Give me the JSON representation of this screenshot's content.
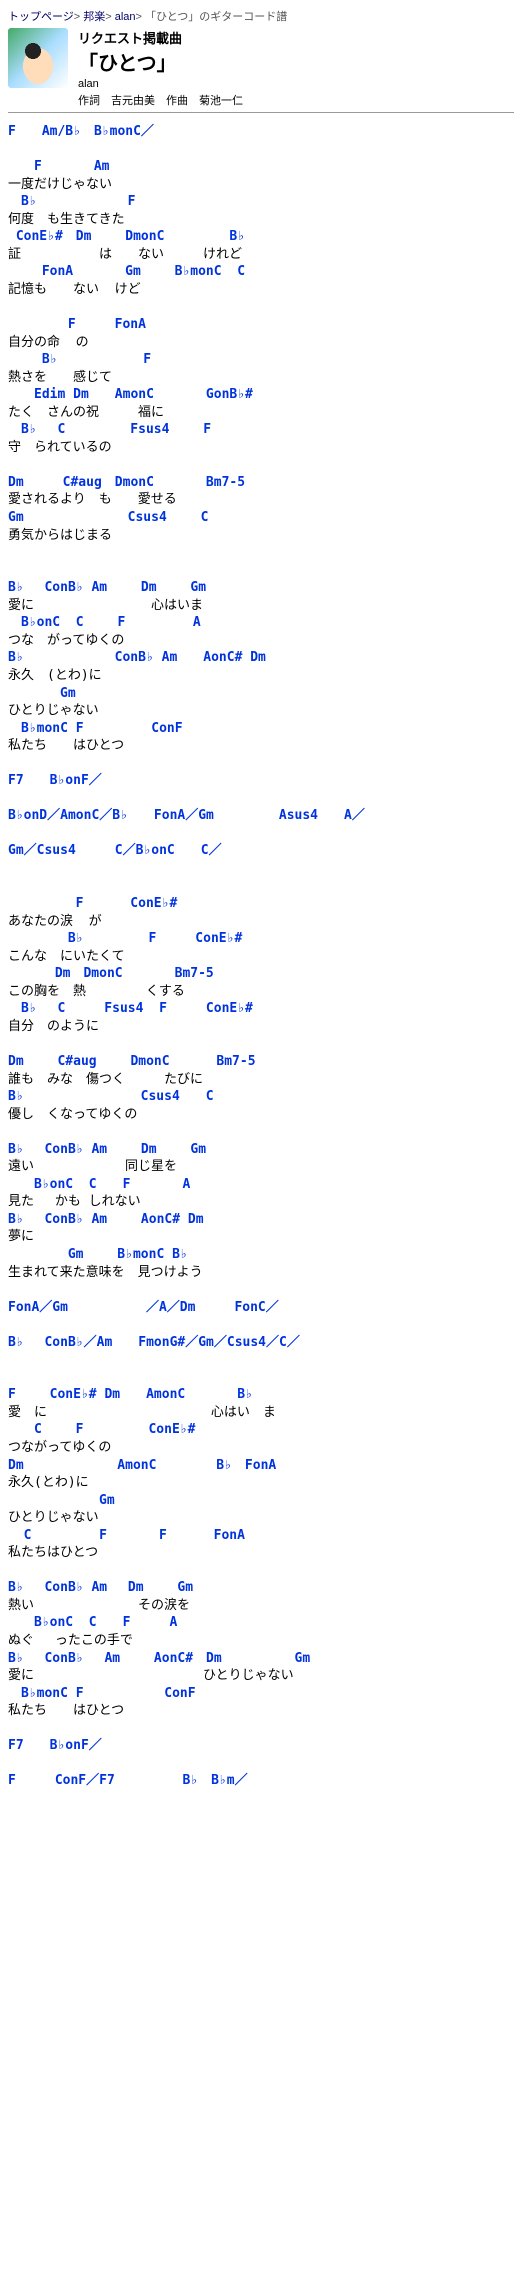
{
  "bc": {
    "p1": "トップページ",
    "p2": "邦楽",
    "p3": "alan",
    "tail": "「ひとつ」のギターコード譜"
  },
  "hd": {
    "req": "リクエスト掲載曲",
    "title": "「ひとつ」",
    "artist": "alan",
    "credit": "作詞　吉元由美　作曲　菊池一仁"
  },
  "lines": [
    {
      "t": "c",
      "v": "F　　Am/B♭　B♭monC／"
    },
    {
      "t": "b"
    },
    {
      "t": "c",
      "v": "　　F　　　　Am"
    },
    {
      "t": "l",
      "v": "一度だけじゃない"
    },
    {
      "t": "c",
      "v": "　B♭　　　　　　　F"
    },
    {
      "t": "l",
      "v": "何度　も生きてきた"
    },
    {
      "t": "c",
      "v": " ConE♭#　Dm　　 DmonC　　　　　B♭"
    },
    {
      "t": "l",
      "v": "証　　　　　　は　　ない　　　けれど"
    },
    {
      "t": "c",
      "v": "　　 FonA　　　　Gm　　 B♭monC  C"
    },
    {
      "t": "l",
      "v": "記憶も　　ない  けど"
    },
    {
      "t": "b"
    },
    {
      "t": "c",
      "v": "　　　　 F　　　FonA"
    },
    {
      "t": "l",
      "v": "自分の命  の"
    },
    {
      "t": "c",
      "v": "　　 B♭　　　　　　 F"
    },
    {
      "t": "l",
      "v": "熱さを　　感じて"
    },
    {
      "t": "c",
      "v": "　　Edim Dm　　AmonC　　　　GonB♭#"
    },
    {
      "t": "l",
      "v": "たく　さんの祝　　　福に"
    },
    {
      "t": "c",
      "v": "　B♭　 C　　　　　Fsus4　　 F"
    },
    {
      "t": "l",
      "v": "守　られているの"
    },
    {
      "t": "b"
    },
    {
      "t": "c",
      "v": "Dm　　　C#aug　DmonC　　　　Bm7-5"
    },
    {
      "t": "l",
      "v": "愛されるより　も　　愛せる"
    },
    {
      "t": "c",
      "v": "Gm　　　　　　　　Csus4　　 C"
    },
    {
      "t": "l",
      "v": "勇気からはじまる"
    },
    {
      "t": "b"
    },
    {
      "t": "b"
    },
    {
      "t": "c",
      "v": "B♭　 ConB♭ Am　　 Dm　　 Gm"
    },
    {
      "t": "l",
      "v": "愛に　　　　　　　　　心はいま"
    },
    {
      "t": "c",
      "v": "　B♭onC  C　　 F　　　　  A"
    },
    {
      "t": "l",
      "v": "つな　がってゆくの"
    },
    {
      "t": "c",
      "v": "B♭　　　　　　　ConB♭ Am　　AonC# Dm"
    },
    {
      "t": "l",
      "v": "永久　(とわ)に"
    },
    {
      "t": "c",
      "v": "　　　　Gm"
    },
    {
      "t": "l",
      "v": "ひとりじゃない"
    },
    {
      "t": "c",
      "v": "　B♭monC F　　　　  ConF"
    },
    {
      "t": "l",
      "v": "私たち　　はひとつ"
    },
    {
      "t": "b"
    },
    {
      "t": "c",
      "v": "F7　　B♭onF／"
    },
    {
      "t": "b"
    },
    {
      "t": "c",
      "v": "B♭onD／AmonC／B♭　　FonA／Gm　　　　　Asus4　　A／"
    },
    {
      "t": "b"
    },
    {
      "t": "c",
      "v": "Gm／Csus4　　　C／B♭onC　　C／"
    },
    {
      "t": "b"
    },
    {
      "t": "b"
    },
    {
      "t": "c",
      "v": "　　　　  F　　　 ConE♭#"
    },
    {
      "t": "l",
      "v": "あなたの涙  が"
    },
    {
      "t": "c",
      "v": "　　　　 B♭　　　　　F　　　ConE♭#"
    },
    {
      "t": "l",
      "v": "こんな　にいたくて"
    },
    {
      "t": "c",
      "v": "　　　 Dm　DmonC　　　　Bm7-5"
    },
    {
      "t": "l",
      "v": "この胸を　熱　　　　 くする"
    },
    {
      "t": "c",
      "v": "　B♭　 C　　　Fsus4  F　　　ConE♭#"
    },
    {
      "t": "l",
      "v": "自分　のように"
    },
    {
      "t": "b"
    },
    {
      "t": "c",
      "v": "Dm　　 C#aug　 　DmonC　 　　Bm7-5"
    },
    {
      "t": "l",
      "v": "誰も　みな　傷つく　　　たびに"
    },
    {
      "t": "c",
      "v": "B♭　　　　　　　　　Csus4　　C"
    },
    {
      "t": "l",
      "v": "優し　くなってゆくの"
    },
    {
      "t": "b"
    },
    {
      "t": "c",
      "v": "B♭　 ConB♭ Am　　 Dm　　 Gm"
    },
    {
      "t": "l",
      "v": "遠い　　　　　　　同じ星を"
    },
    {
      "t": "c",
      "v": "　　B♭onC  C　　F　　　　A"
    },
    {
      "t": "l",
      "v": "見た　 かも しれない"
    },
    {
      "t": "c",
      "v": "B♭　 ConB♭ Am　　 AonC# Dm"
    },
    {
      "t": "l",
      "v": "夢に"
    },
    {
      "t": "c",
      "v": "　　　　 Gm　　 B♭monC B♭"
    },
    {
      "t": "l",
      "v": "生まれて来た意味を　見つけよう"
    },
    {
      "t": "b"
    },
    {
      "t": "c",
      "v": "FonA／Gm　　　　　　／A／Dm　　　FonC／"
    },
    {
      "t": "b"
    },
    {
      "t": "c",
      "v": "B♭　 ConB♭／Am　　FmonG#／Gm／Csus4／C／"
    },
    {
      "t": "b"
    },
    {
      "t": "b"
    },
    {
      "t": "c",
      "v": "F　　 ConE♭# Dm　　AmonC　　　　B♭"
    },
    {
      "t": "l",
      "v": "愛　に　　　　　　　　　　　　 心はい　ま"
    },
    {
      "t": "c",
      "v": "　　C　　 F　　　　　ConE♭#"
    },
    {
      "t": "l",
      "v": "つながってゆくの"
    },
    {
      "t": "c",
      "v": "Dm 　　　　　　 AmonC　　 　　B♭　FonA"
    },
    {
      "t": "l",
      "v": "永久(とわ)に"
    },
    {
      "t": "c",
      "v": "　　　　　　　Gm"
    },
    {
      "t": "l",
      "v": "ひとりじゃない"
    },
    {
      "t": "c",
      "v": "  C　　　　  F　　　　F　　　 FonA"
    },
    {
      "t": "l",
      "v": "私たちはひとつ"
    },
    {
      "t": "b"
    },
    {
      "t": "c",
      "v": "B♭　 ConB♭ Am　 Dm　　 Gm"
    },
    {
      "t": "l",
      "v": "熱い　　　　　　　　その涙を"
    },
    {
      "t": "c",
      "v": "　　B♭onC  C　　F　　　A"
    },
    {
      "t": "l",
      "v": "ぬぐ　 ったこの手で"
    },
    {
      "t": "c",
      "v": "B♭　 ConB♭　 Am　　 AonC#　Dm 　　　　　Gm"
    },
    {
      "t": "l",
      "v": "愛に　　　　　　　　　　　　　ひとりじゃない"
    },
    {
      "t": "c",
      "v": "　B♭monC F　　　　　  ConF"
    },
    {
      "t": "l",
      "v": "私たち　　はひとつ"
    },
    {
      "t": "b"
    },
    {
      "t": "c",
      "v": "F7　　B♭onF／"
    },
    {
      "t": "b"
    },
    {
      "t": "c",
      "v": "F　　　ConF／F7　　　　  B♭　B♭m／"
    }
  ]
}
